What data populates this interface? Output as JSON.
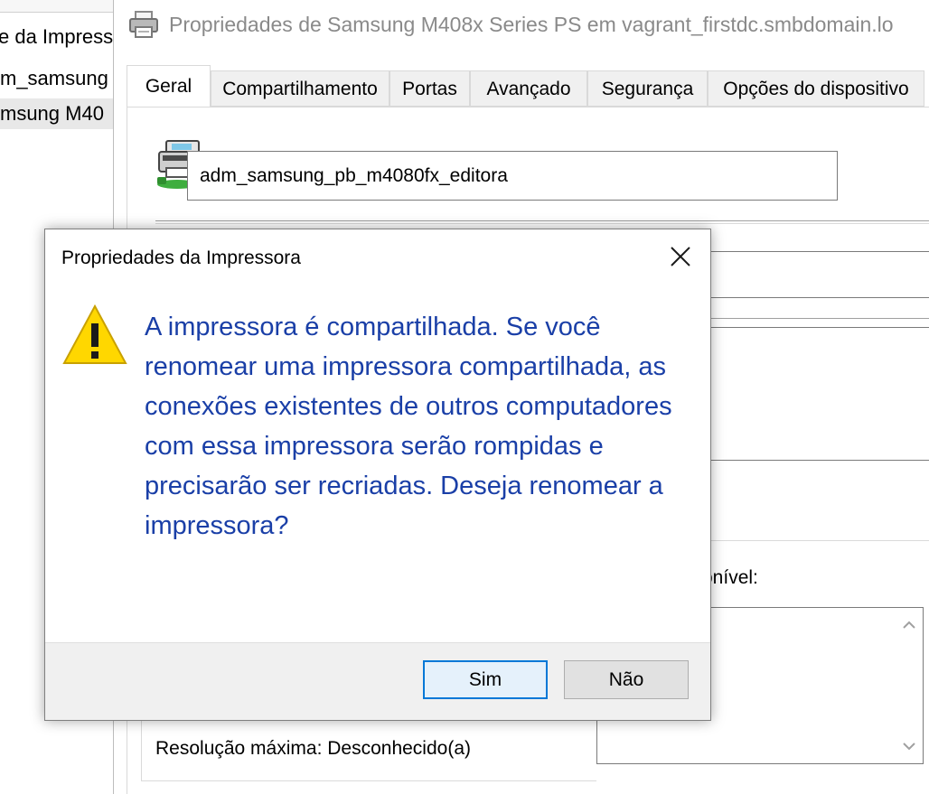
{
  "background_window": {
    "rows": [
      "e da Impress",
      "m_samsung",
      "msung M40"
    ]
  },
  "properties_window": {
    "title": "Propriedades de Samsung M408x Series PS em vagrant_firstdc.smbdomain.lo",
    "tabs": [
      "Geral",
      "Compartilhamento",
      "Portas",
      "Avançado",
      "Segurança",
      "Opções do dispositivo"
    ],
    "active_tab": "Geral",
    "printer_name": "adm_samsung_pb_m4080fx_editora",
    "available_label_partial": "onível:",
    "max_resolution": "Resolução máxima: Desconhecido(a)"
  },
  "dialog": {
    "title": "Propriedades da Impressora",
    "message": "A impressora é compartilhada. Se você renomear uma impressora compartilhada, as conexões existentes de outros computadores com essa impressora serão rompidas e precisarão ser recriadas. Deseja renomear a impressora?",
    "yes_label": "Sim",
    "no_label": "Não"
  },
  "colors": {
    "message_text": "#1a3fa7",
    "default_button_border": "#0078d7",
    "warning_fill": "#ffd700"
  },
  "icons": [
    "printer-icon",
    "printer-shared-icon",
    "close-icon",
    "warning-icon",
    "scroll-up-icon",
    "scroll-down-icon"
  ]
}
